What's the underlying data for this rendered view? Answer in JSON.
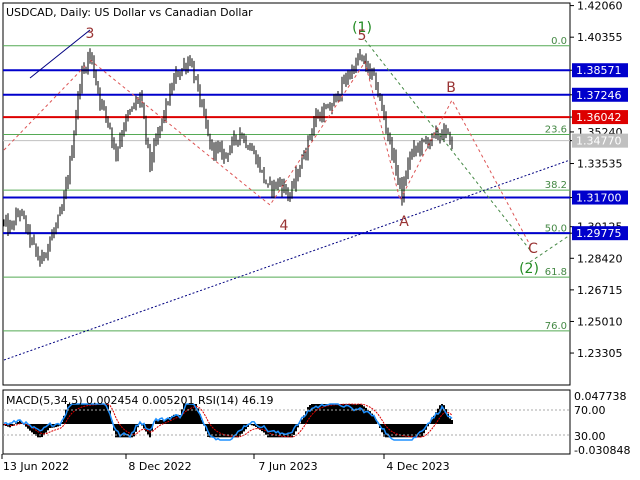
{
  "chart_data": [
    {
      "type": "bar",
      "title": "USDCAD, Daily:  US Dollar vs Canadian Dollar",
      "ylim": [
        1.2158,
        1.422
      ],
      "y_ticks": [
        "1.42060",
        "1.40355",
        "1.38571",
        "1.37246",
        "1.36042",
        "1.35240",
        "1.34770",
        "1.33535",
        "1.31700",
        "1.30125",
        "1.29775",
        "1.28420",
        "1.26715",
        "1.25010",
        "1.23305"
      ],
      "x_ticks": [
        "13 Jun 2022",
        "8 Dec 2022",
        "7 Jun 2023",
        "4 Dec 2023"
      ],
      "price_levels": [
        {
          "value": 1.38571,
          "color": "#0000cc",
          "label": "1.38571"
        },
        {
          "value": 1.37246,
          "color": "#0000cc",
          "label": "1.37246"
        },
        {
          "value": 1.36042,
          "color": "#dd0000",
          "label": "1.36042"
        },
        {
          "value": 1.3477,
          "color": "#c0c0c0",
          "label": "1.34770"
        },
        {
          "value": 1.317,
          "color": "#0000cc",
          "label": "1.31700"
        },
        {
          "value": 1.29775,
          "color": "#0000cc",
          "label": "1.29775"
        }
      ],
      "fibo_levels": [
        {
          "label": "0.0",
          "value": 1.3989
        },
        {
          "label": "23.6",
          "value": 1.351
        },
        {
          "label": "38.2",
          "value": 1.321
        },
        {
          "label": "50.0",
          "value": 1.2975
        },
        {
          "label": "61.8",
          "value": 1.274
        },
        {
          "label": "76.0",
          "value": 1.245
        }
      ],
      "wave_labels": [
        {
          "text": "3",
          "color": "#993333"
        },
        {
          "text": "(1)",
          "color": "#228b22"
        },
        {
          "text": "5",
          "color": "#993333"
        },
        {
          "text": "4",
          "color": "#993333"
        },
        {
          "text": "B",
          "color": "#993333"
        },
        {
          "text": "A",
          "color": "#993333"
        },
        {
          "text": "C",
          "color": "#993333"
        },
        {
          "text": "(2)",
          "color": "#228b22"
        }
      ],
      "colors": {
        "candle": "#000000",
        "fibo": "#55aa55",
        "wave_red": "#dd5555",
        "wave_green": "#448844",
        "trend": "#000080"
      }
    },
    {
      "type": "bar",
      "title": "MACD(5,34,5) 0.002454 0.005201 RSI(14) 46.19",
      "y_ticks": [
        "0.047738",
        "70.00",
        "30.00",
        "-0.030848"
      ],
      "x_ticks": [
        "13 Jun 2022",
        "8 Dec 2022",
        "7 Jun 2023",
        "4 Dec 2023"
      ],
      "colors": {
        "histogram": "#000000",
        "signal": "#dd0000",
        "rsi": "#1e90ff"
      }
    }
  ]
}
